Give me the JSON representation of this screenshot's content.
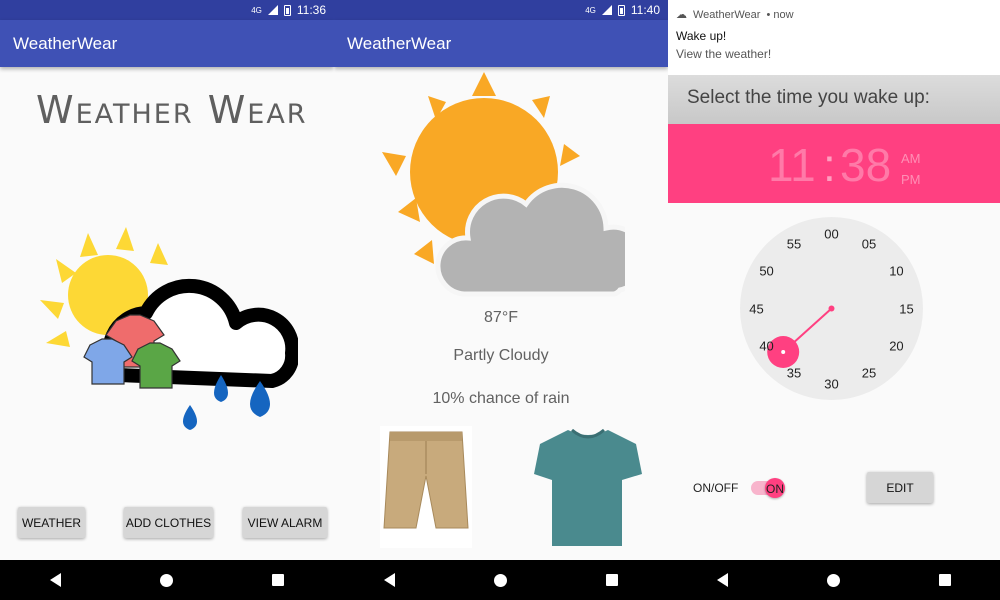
{
  "screen1": {
    "status_time": "11:36",
    "network": "4G",
    "app_title": "WeatherWear",
    "brand_title": "Weather Wear",
    "buttons": {
      "weather": "WEATHER",
      "add_clothes": "ADD CLOTHES",
      "view_alarm": "VIEW ALARM"
    }
  },
  "screen2": {
    "status_time": "11:40",
    "network": "4G",
    "app_title": "WeatherWear",
    "temperature": "87°F",
    "condition": "Partly Cloudy",
    "rain_chance": "10% chance of rain"
  },
  "screen3": {
    "notification": {
      "app": "WeatherWear",
      "when": "• now",
      "title": "Wake up!",
      "body": "View the weather!"
    },
    "picker_header": "Select the time you wake up:",
    "time": {
      "hour": "11",
      "sep": ":",
      "minute": "38",
      "am": "AM",
      "pm": "PM"
    },
    "clock_numbers": [
      "00",
      "05",
      "10",
      "15",
      "20",
      "25",
      "30",
      "35",
      "40",
      "45",
      "50",
      "55"
    ],
    "selected_minute": 38,
    "toggle_label": "ON/OFF",
    "toggle_state": "ON",
    "edit_button": "EDIT"
  },
  "colors": {
    "primary": "#3f51b5",
    "primary_dark": "#303f9f",
    "accent": "#ff4081",
    "sun": "#fdd835",
    "sun_orange": "#f9a825",
    "cloud_gray": "#b0b0b0"
  },
  "icons": [
    "weather-illustration-icon",
    "partly-cloudy-icon",
    "shorts-icon",
    "tshirt-icon",
    "back-icon",
    "home-icon",
    "recents-icon"
  ]
}
